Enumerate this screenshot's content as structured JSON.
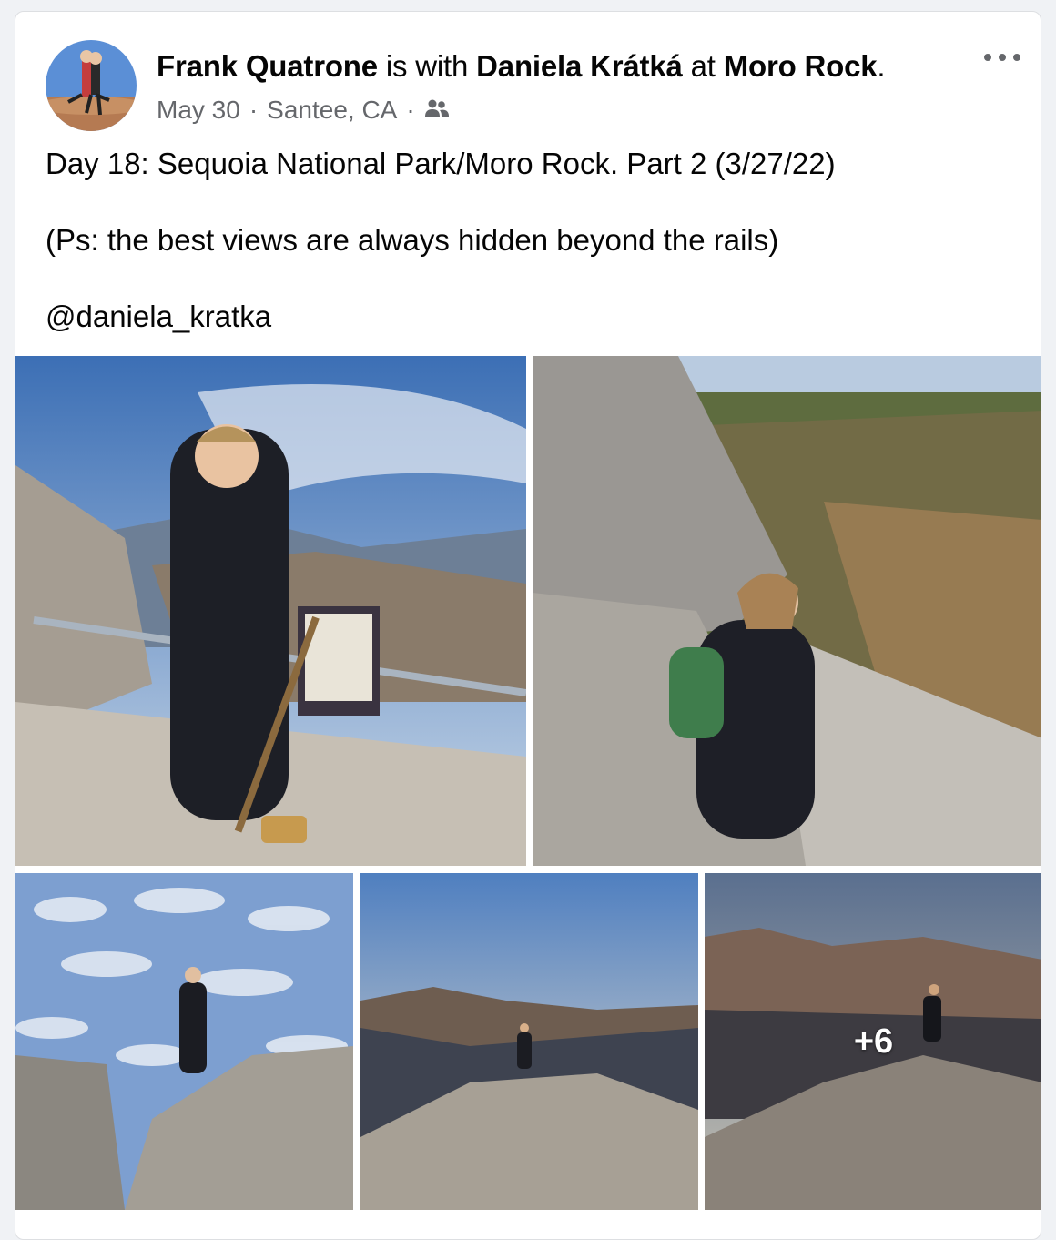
{
  "post": {
    "author": "Frank Quatrone",
    "with_text": "is with",
    "tagged": "Daniela Krátká",
    "at_text": "at",
    "place": "Moro Rock",
    "period": ".",
    "date": "May 30",
    "location": "Santee, CA",
    "audience_icon": "friends-icon",
    "line1": "Day 18: Sequoia National Park/Moro Rock. Part 2 (3/27/22)",
    "line2": "(Ps: the best views are always hidden beyond the rails)",
    "line3": "@daniela_kratka"
  },
  "photos": {
    "more_count": "+6"
  },
  "colors": {
    "meta": "#65676b",
    "sky": "#6f95c8",
    "rock": "#b8b1a6"
  }
}
